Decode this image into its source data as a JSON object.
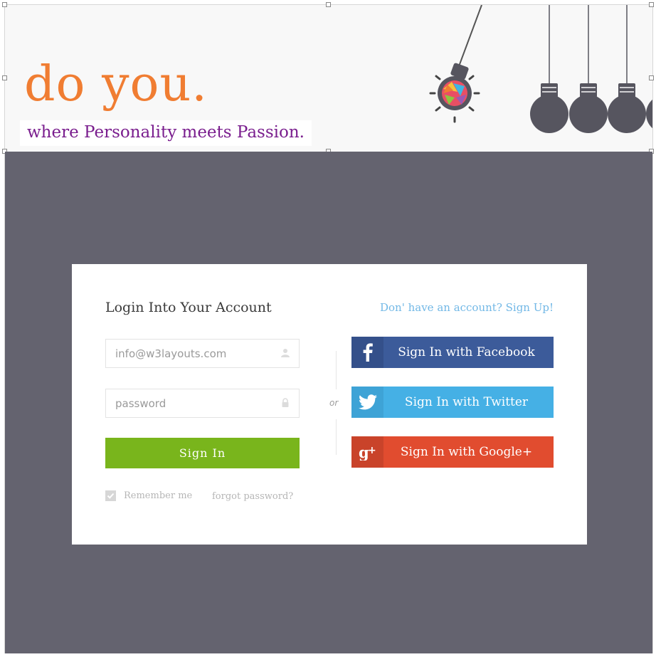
{
  "header": {
    "brand": "do you.",
    "tagline": "where Personality meets Passion."
  },
  "login": {
    "title": "Login Into Your Account",
    "signup_link": "Don' have an account? Sign Up!",
    "email_placeholder": "info@w3layouts.com",
    "password_placeholder": "password",
    "signin_label": "Sign In",
    "remember_label": "Remember me",
    "remember_checked": true,
    "forgot_label": "forgot password?",
    "or_label": "or"
  },
  "social": {
    "facebook_label": "Sign In with Facebook",
    "twitter_label": "Sign In with Twitter",
    "google_label": "Sign In with Google+"
  },
  "colors": {
    "brand": "#f07d32",
    "tagline": "#7a1e8e",
    "background": "#64636f",
    "signin": "#79b51c",
    "facebook": "#3c5b9a",
    "twitter": "#45b0e5",
    "google": "#e14c2f",
    "link": "#72b8e6"
  },
  "icons": [
    "lightbulb-icon",
    "user-icon",
    "lock-icon",
    "check-icon",
    "facebook-icon",
    "twitter-icon",
    "google-plus-icon"
  ]
}
